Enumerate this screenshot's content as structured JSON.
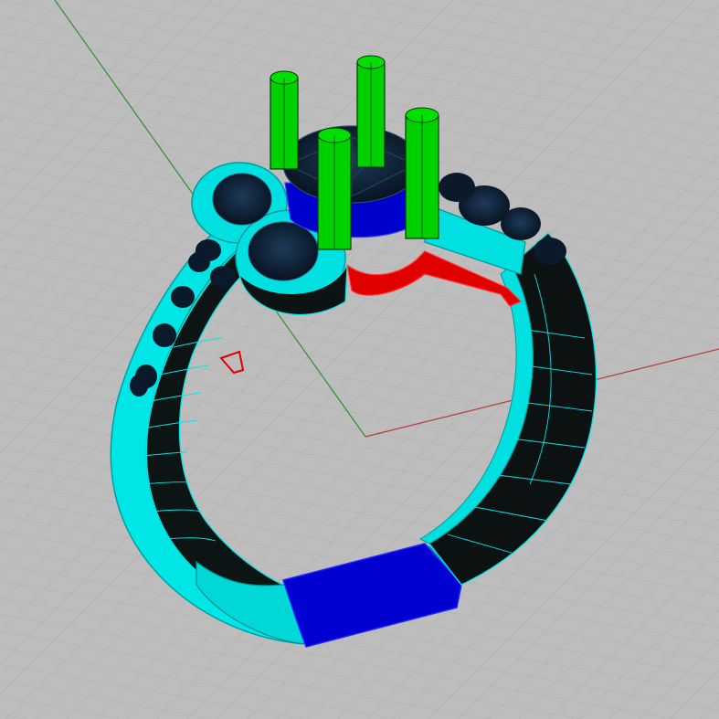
{
  "scene": {
    "colors": {
      "background": "#bdbdbd",
      "grid_line": "#a9a9a9",
      "grid_major": "#9f9f9f",
      "x_axis": "#b23a3a",
      "y_axis": "#2e8b2e",
      "shank_edge": "#00e8e8",
      "shank_face": "#002a2a",
      "shank_face_light": "#1a1a1a",
      "blue_band": "#0000cc",
      "prong": "#00cc00",
      "prong_edge": "#003300",
      "stone": "#0a1a2e",
      "stone_wire": "#2a4a6a",
      "gallery": "#dd0000"
    },
    "objects": [
      {
        "name": "ring-shank",
        "icon": "ring-shank"
      },
      {
        "name": "center-stone",
        "icon": "gem"
      },
      {
        "name": "prongs",
        "icon": "prong",
        "count": 4
      },
      {
        "name": "side-stones",
        "icon": "gem"
      },
      {
        "name": "gallery-rail",
        "icon": "rail"
      }
    ]
  }
}
